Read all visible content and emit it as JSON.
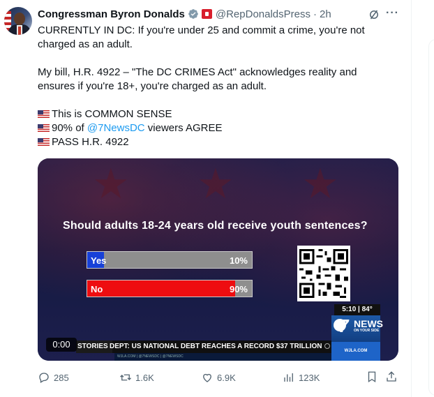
{
  "tweet": {
    "author_name": "Congressman Byron Donalds",
    "handle": "@RepDonaldsPress",
    "separator": "·",
    "time": "2h",
    "lines": {
      "l1": "CURRENTLY IN DC: If you're under 25 and commit a crime, you're not",
      "l2": "charged as an adult.",
      "l3": "My bill, H.R. 4922 – \"The DC CRIMES Act\" acknowledges reality and",
      "l4": "ensures if you're 18+, you're charged as an adult.",
      "l5": "This is COMMON SENSE",
      "l6_pre": "90% of ",
      "l6_mention": "@7NewsDC",
      "l6_post": " viewers AGREE",
      "l7": "PASS H.R. 4922"
    }
  },
  "video": {
    "question": "Should adults 18-24 years old receive youth sentences?",
    "poll": [
      {
        "label": "Yes",
        "percent_label": "10%",
        "fraction": 0.1,
        "color": "#1740d8"
      },
      {
        "label": "No",
        "percent_label": "90%",
        "fraction": 0.9,
        "color": "#ee0d10"
      }
    ],
    "time_weather": "5:10 | 84°",
    "station_word": "NEWS",
    "station_sub": "ON YOUR SIDE",
    "station_number": "7",
    "website": "WJLA.COM",
    "ticker_tag": "STORIES",
    "ticker_headline": "DEPT: US NATIONAL DEBT REACHES A RECORD $37 TRILLION",
    "sub_ticker": "WJLA.COM | @7NEWSDC | @7NEWSDC",
    "timer": "0:00"
  },
  "actions": {
    "replies": "285",
    "reposts": "1.6K",
    "likes": "6.9K",
    "views": "123K"
  },
  "colors": {
    "link": "#1d9bf0",
    "meta": "#536471",
    "verified": "#829aab"
  }
}
